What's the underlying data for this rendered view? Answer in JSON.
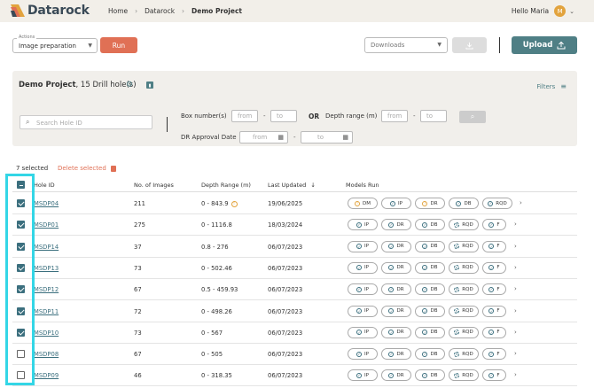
{
  "header": {
    "logo_text": "Datarock",
    "breadcrumbs": [
      "Home",
      "Datarock",
      "Demo Project"
    ],
    "greeting": "Hello Maria",
    "avatar_initial": "M"
  },
  "toolbar": {
    "actions_legend": "Actions",
    "actions_value": "Image preparation",
    "run_label": "Run",
    "downloads_placeholder": "Downloads",
    "upload_label": "Upload"
  },
  "project": {
    "name": "Demo Project",
    "holes_text": ", 15 Drill hole(s)",
    "filters_label": "Filters",
    "search_placeholder": "Search Hole ID",
    "box_label": "Box number(s)",
    "from_placeholder": "from",
    "to_placeholder": "to",
    "or_label": "OR",
    "depth_label": "Depth range (m)",
    "approval_label": "DR Approval Date"
  },
  "selection": {
    "count_text": "7 selected",
    "delete_label": "Delete selected"
  },
  "table": {
    "columns": [
      "Hole ID",
      "No. of Images",
      "Depth Range (m)",
      "Last Updated",
      "Models Run"
    ],
    "sort_indicator": "↓",
    "rows": [
      {
        "id": "MSDP04",
        "images": "211",
        "depth": "0 - 843.9",
        "updated": "19/06/2025",
        "checked": true,
        "warn": true,
        "models": [
          [
            "DM",
            "pending"
          ],
          [
            "IP",
            "done"
          ],
          [
            "DR",
            "pending"
          ],
          [
            "DB",
            "done"
          ],
          [
            "RQD",
            "done"
          ]
        ]
      },
      {
        "id": "MSDP01",
        "images": "275",
        "depth": "0 - 1116.8",
        "updated": "18/03/2024",
        "checked": true,
        "models": [
          [
            "IP",
            "done"
          ],
          [
            "DR",
            "done"
          ],
          [
            "DB",
            "done"
          ],
          [
            "RQD",
            "partial"
          ],
          [
            "F",
            "done"
          ]
        ]
      },
      {
        "id": "MSDP14",
        "images": "37",
        "depth": "0.8 - 276",
        "updated": "06/07/2023",
        "checked": true,
        "models": [
          [
            "IP",
            "done"
          ],
          [
            "DR",
            "done"
          ],
          [
            "DB",
            "done"
          ],
          [
            "RQD",
            "partial"
          ],
          [
            "F",
            "done"
          ]
        ]
      },
      {
        "id": "MSDP13",
        "images": "73",
        "depth": "0 - 502.46",
        "updated": "06/07/2023",
        "checked": true,
        "models": [
          [
            "IP",
            "done"
          ],
          [
            "DR",
            "done"
          ],
          [
            "DB",
            "done"
          ],
          [
            "RQD",
            "partial"
          ],
          [
            "F",
            "done"
          ]
        ]
      },
      {
        "id": "MSDP12",
        "images": "67",
        "depth": "0.5 - 459.93",
        "updated": "06/07/2023",
        "checked": true,
        "models": [
          [
            "IP",
            "done"
          ],
          [
            "DR",
            "done"
          ],
          [
            "DB",
            "done"
          ],
          [
            "RQD",
            "partial"
          ],
          [
            "F",
            "done"
          ]
        ]
      },
      {
        "id": "MSDP11",
        "images": "72",
        "depth": "0 - 498.26",
        "updated": "06/07/2023",
        "checked": true,
        "models": [
          [
            "IP",
            "done"
          ],
          [
            "DR",
            "done"
          ],
          [
            "DB",
            "done"
          ],
          [
            "RQD",
            "partial"
          ],
          [
            "F",
            "done"
          ]
        ]
      },
      {
        "id": "MSDP10",
        "images": "73",
        "depth": "0 - 567",
        "updated": "06/07/2023",
        "checked": true,
        "models": [
          [
            "IP",
            "done"
          ],
          [
            "DR",
            "done"
          ],
          [
            "DB",
            "done"
          ],
          [
            "RQD",
            "partial"
          ],
          [
            "F",
            "done"
          ]
        ]
      },
      {
        "id": "MSDP08",
        "images": "67",
        "depth": "0 - 505",
        "updated": "06/07/2023",
        "checked": false,
        "models": [
          [
            "IP",
            "done"
          ],
          [
            "DR",
            "done"
          ],
          [
            "DB",
            "done"
          ],
          [
            "RQD",
            "partial"
          ],
          [
            "F",
            "done"
          ]
        ]
      },
      {
        "id": "MSDP09",
        "images": "46",
        "depth": "0 - 318.35",
        "updated": "06/07/2023",
        "checked": false,
        "models": [
          [
            "IP",
            "done"
          ],
          [
            "DR",
            "done"
          ],
          [
            "DB",
            "done"
          ],
          [
            "RQD",
            "partial"
          ],
          [
            "F",
            "done"
          ]
        ]
      }
    ]
  },
  "colors": {
    "accent": "#4f7f85",
    "run": "#e07055",
    "highlight": "#33d6e6",
    "topbar": "#f2efe9"
  }
}
